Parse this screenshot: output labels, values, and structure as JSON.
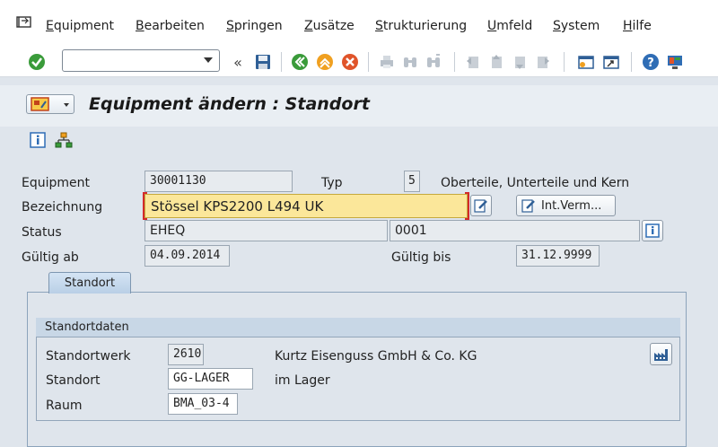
{
  "menu": [
    "Equipment",
    "Bearbeiten",
    "Springen",
    "Zusätze",
    "Strukturierung",
    "Umfeld",
    "System",
    "Hilfe"
  ],
  "menu_underline": [
    "E",
    "B",
    "S",
    "Z",
    "S",
    "U",
    "S",
    "H"
  ],
  "toolbar": {
    "command_value": ""
  },
  "title": "Equipment ändern : Standort",
  "form": {
    "equipment_label": "Equipment",
    "equipment_value": "30001130",
    "typ_label": "Typ",
    "typ_value": "5",
    "typ_text": "Oberteile, Unterteile und Kern",
    "bezeichnung_label": "Bezeichnung",
    "bezeichnung_value": "Stössel KPS2200 L494 UK",
    "intverm_label": "Int.Verm...",
    "status_label": "Status",
    "status_value": "EHEQ",
    "status_value2": "0001",
    "gueltig_ab_label": "Gültig ab",
    "gueltig_ab_value": "04.09.2014",
    "gueltig_bis_label": "Gültig bis",
    "gueltig_bis_value": "31.12.9999"
  },
  "tab": {
    "label": "Standort"
  },
  "group": {
    "title": "Standortdaten",
    "werk_label": "Standortwerk",
    "werk_value": "2610",
    "werk_text": "Kurtz Eisenguss GmbH & Co. KG",
    "standort_label": "Standort",
    "standort_value": "GG-LAGER",
    "standort_text": "im Lager",
    "raum_label": "Raum",
    "raum_value": "BMA_03-4"
  }
}
